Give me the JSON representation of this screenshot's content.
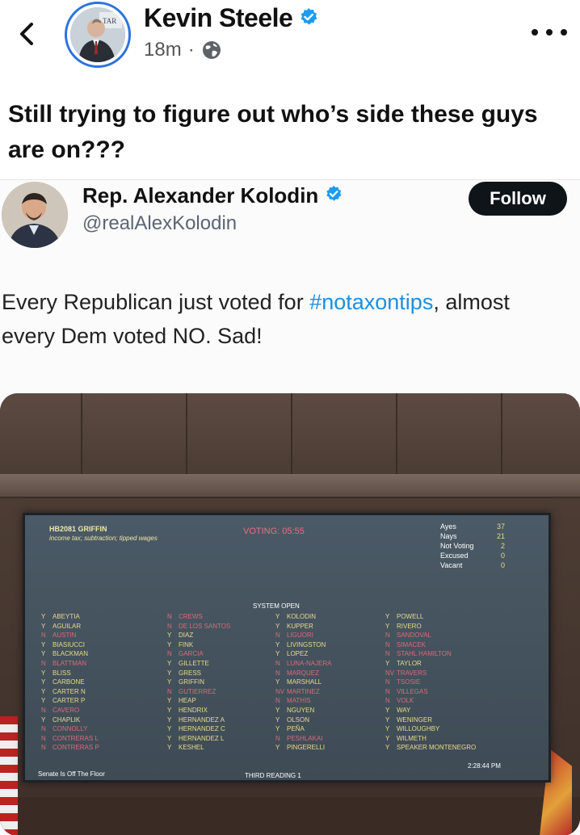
{
  "post": {
    "author": "Kevin Steele",
    "time": "18m",
    "meta_separator": "·",
    "text": "Still trying to figure out who’s side these guys are on???",
    "audience_icon": "globe-icon",
    "avatar_sign_text": "TAR"
  },
  "tweet": {
    "name": "Rep. Alexander Kolodin",
    "handle": "@realAlexKolodin",
    "follow_label": "Follow",
    "text_before": "Every Republican just voted for ",
    "hashtag": "#notaxontips",
    "text_after": ", almost every Dem voted NO. Sad!"
  },
  "board": {
    "bill": "HB2081 GRIFFIN",
    "description": "income tax; subtraction; tipped wages",
    "voting": "VOTING: 05:55",
    "system_status": "SYSTEM OPEN",
    "tally": [
      {
        "label": "Ayes",
        "value": "37"
      },
      {
        "label": "Nays",
        "value": "21"
      },
      {
        "label": "Not Voting",
        "value": "2"
      },
      {
        "label": "Excused",
        "value": "0"
      },
      {
        "label": "Vacant",
        "value": "0"
      }
    ],
    "columns": [
      [
        {
          "v": "Y",
          "n": "ABEYTIA"
        },
        {
          "v": "Y",
          "n": "AGUILAR"
        },
        {
          "v": "N",
          "n": "AUSTIN"
        },
        {
          "v": "Y",
          "n": "BIASIUCCI"
        },
        {
          "v": "Y",
          "n": "BLACKMAN"
        },
        {
          "v": "N",
          "n": "BLATTMAN"
        },
        {
          "v": "Y",
          "n": "BLISS"
        },
        {
          "v": "Y",
          "n": "CARBONE"
        },
        {
          "v": "Y",
          "n": "CARTER N"
        },
        {
          "v": "Y",
          "n": "CARTER P"
        },
        {
          "v": "N",
          "n": "CAVERO"
        },
        {
          "v": "Y",
          "n": "CHAPLIK"
        },
        {
          "v": "N",
          "n": "CONNOLLY"
        },
        {
          "v": "N",
          "n": "CONTRERAS L"
        },
        {
          "v": "N",
          "n": "CONTRERAS P"
        }
      ],
      [
        {
          "v": "N",
          "n": "CREWS"
        },
        {
          "v": "N",
          "n": "DE LOS SANTOS"
        },
        {
          "v": "Y",
          "n": "DIAZ"
        },
        {
          "v": "Y",
          "n": "FINK"
        },
        {
          "v": "N",
          "n": "GARCIA"
        },
        {
          "v": "Y",
          "n": "GILLETTE"
        },
        {
          "v": "Y",
          "n": "GRESS"
        },
        {
          "v": "Y",
          "n": "GRIFFIN"
        },
        {
          "v": "N",
          "n": "GUTIERREZ"
        },
        {
          "v": "Y",
          "n": "HEAP"
        },
        {
          "v": "Y",
          "n": "HENDRIX"
        },
        {
          "v": "Y",
          "n": "HERNANDEZ A"
        },
        {
          "v": "Y",
          "n": "HERNANDEZ C"
        },
        {
          "v": "Y",
          "n": "HERNANDEZ L"
        },
        {
          "v": "Y",
          "n": "KESHEL"
        }
      ],
      [
        {
          "v": "Y",
          "n": "KOLODIN"
        },
        {
          "v": "Y",
          "n": "KUPPER"
        },
        {
          "v": "N",
          "n": "LIGUORI"
        },
        {
          "v": "Y",
          "n": "LIVINGSTON"
        },
        {
          "v": "Y",
          "n": "LOPEZ"
        },
        {
          "v": "N",
          "n": "LUNA-NAJERA"
        },
        {
          "v": "N",
          "n": "MARQUEZ"
        },
        {
          "v": "Y",
          "n": "MARSHALL"
        },
        {
          "v": "NV",
          "n": "MARTINEZ"
        },
        {
          "v": "N",
          "n": "MATHIS"
        },
        {
          "v": "Y",
          "n": "NGUYEN"
        },
        {
          "v": "Y",
          "n": "OLSON"
        },
        {
          "v": "Y",
          "n": "PEÑA"
        },
        {
          "v": "N",
          "n": "PESHLAKAI"
        },
        {
          "v": "Y",
          "n": "PINGERELLI"
        }
      ],
      [
        {
          "v": "Y",
          "n": "POWELL"
        },
        {
          "v": "Y",
          "n": "RIVERO"
        },
        {
          "v": "N",
          "n": "SANDOVAL"
        },
        {
          "v": "N",
          "n": "SIMACEK"
        },
        {
          "v": "N",
          "n": "STAHL HAMILTON"
        },
        {
          "v": "Y",
          "n": "TAYLOR"
        },
        {
          "v": "NV",
          "n": "TRAVERS"
        },
        {
          "v": "N",
          "n": "TSOSIE"
        },
        {
          "v": "N",
          "n": "VILLEGAS"
        },
        {
          "v": "N",
          "n": "VOLK"
        },
        {
          "v": "Y",
          "n": "WAY"
        },
        {
          "v": "Y",
          "n": "WENINGER"
        },
        {
          "v": "Y",
          "n": "WILLOUGHBY"
        },
        {
          "v": "Y",
          "n": "WILMETH"
        },
        {
          "v": "Y",
          "n": "SPEAKER MONTENEGRO"
        }
      ]
    ],
    "footer_left": "Senate Is Off The Floor",
    "reading": "THIRD READING 1",
    "time": "2:28:44 PM"
  },
  "colors": {
    "verified": "#1d9bf0",
    "hashtag": "#1d8fe0",
    "aye": "#e9d98a",
    "nay": "#d96a7a"
  }
}
